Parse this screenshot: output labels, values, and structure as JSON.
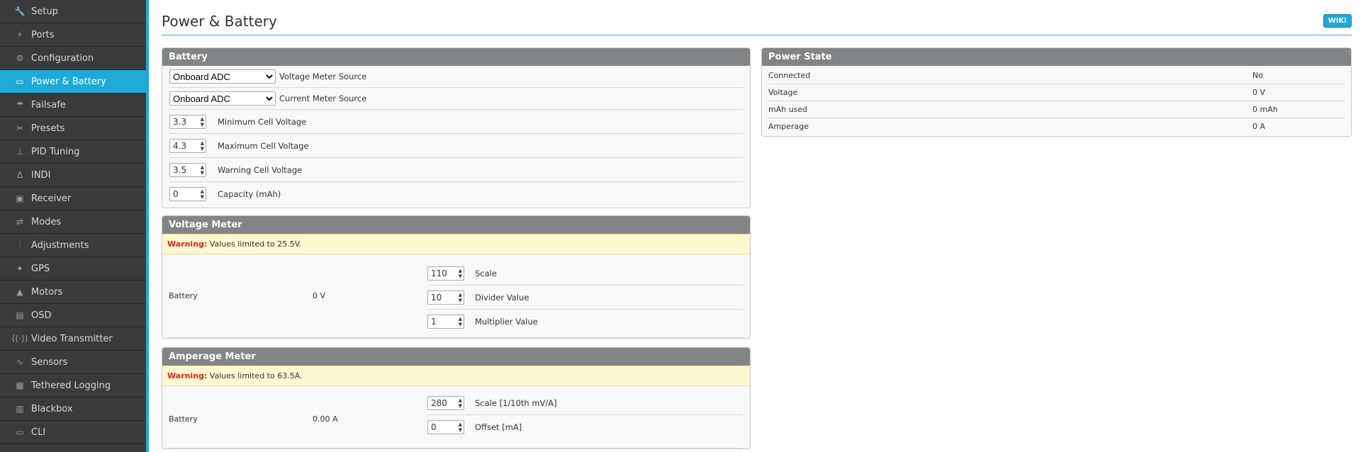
{
  "sidebar": {
    "items": [
      {
        "label": "Setup",
        "icon": "wrench-icon",
        "glyph": "🔧"
      },
      {
        "label": "Ports",
        "icon": "plug-icon",
        "glyph": "⚡"
      },
      {
        "label": "Configuration",
        "icon": "gear-icon",
        "glyph": "⚙"
      },
      {
        "label": "Power & Battery",
        "icon": "battery-icon",
        "glyph": "▭",
        "active": true
      },
      {
        "label": "Failsafe",
        "icon": "parachute-icon",
        "glyph": "☂"
      },
      {
        "label": "Presets",
        "icon": "presets-icon",
        "glyph": "✂"
      },
      {
        "label": "PID Tuning",
        "icon": "pid-icon",
        "glyph": "⊥"
      },
      {
        "label": "INDI",
        "icon": "indi-icon",
        "glyph": "Δ"
      },
      {
        "label": "Receiver",
        "icon": "receiver-icon",
        "glyph": "▣"
      },
      {
        "label": "Modes",
        "icon": "modes-icon",
        "glyph": "⇄"
      },
      {
        "label": "Adjustments",
        "icon": "sliders-icon",
        "glyph": "⫶"
      },
      {
        "label": "GPS",
        "icon": "satellite-icon",
        "glyph": "✦"
      },
      {
        "label": "Motors",
        "icon": "motor-icon",
        "glyph": "▲"
      },
      {
        "label": "OSD",
        "icon": "osd-icon",
        "glyph": "▤"
      },
      {
        "label": "Video Transmitter",
        "icon": "antenna-icon",
        "glyph": "((·))"
      },
      {
        "label": "Sensors",
        "icon": "sensors-icon",
        "glyph": "∿"
      },
      {
        "label": "Tethered Logging",
        "icon": "logging-icon",
        "glyph": "▦"
      },
      {
        "label": "Blackbox",
        "icon": "blackbox-icon",
        "glyph": "▥"
      },
      {
        "label": "CLI",
        "icon": "terminal-icon",
        "glyph": "▭"
      }
    ]
  },
  "header": {
    "title": "Power & Battery",
    "wiki_label": "WIKI"
  },
  "battery": {
    "title": "Battery",
    "voltage_source": {
      "value": "Onboard ADC",
      "label": "Voltage Meter Source"
    },
    "current_source": {
      "value": "Onboard ADC",
      "label": "Current Meter Source"
    },
    "min_cell": {
      "value": "3.3",
      "label": "Minimum Cell Voltage"
    },
    "max_cell": {
      "value": "4.3",
      "label": "Maximum Cell Voltage"
    },
    "warn_cell": {
      "value": "3.5",
      "label": "Warning Cell Voltage"
    },
    "capacity": {
      "value": "0",
      "label": "Capacity (mAh)"
    }
  },
  "voltage_meter": {
    "title": "Voltage Meter",
    "warning_prefix": "Warning:",
    "warning_text": " Values limited to 25.5V.",
    "name": "Battery",
    "reading": "0 V",
    "scale": {
      "value": "110",
      "label": "Scale"
    },
    "divider": {
      "value": "10",
      "label": "Divider Value"
    },
    "multiplier": {
      "value": "1",
      "label": "Multiplier Value"
    }
  },
  "amperage_meter": {
    "title": "Amperage Meter",
    "warning_prefix": "Warning:",
    "warning_text": " Values limited to 63.5A.",
    "name": "Battery",
    "reading": "0.00 A",
    "scale": {
      "value": "280",
      "label": "Scale [1/10th mV/A]"
    },
    "offset": {
      "value": "0",
      "label": "Offset [mA]"
    }
  },
  "power_state": {
    "title": "Power State",
    "rows": [
      {
        "label": "Connected",
        "value": "No"
      },
      {
        "label": "Voltage",
        "value": "0 V"
      },
      {
        "label": "mAh used",
        "value": "0 mAh"
      },
      {
        "label": "Amperage",
        "value": "0 A"
      }
    ]
  },
  "colors": {
    "accent": "#1fa9d6",
    "sidebar_bg": "#3a3a3a",
    "panel_header": "#828585",
    "warning_red": "#e2231a"
  }
}
